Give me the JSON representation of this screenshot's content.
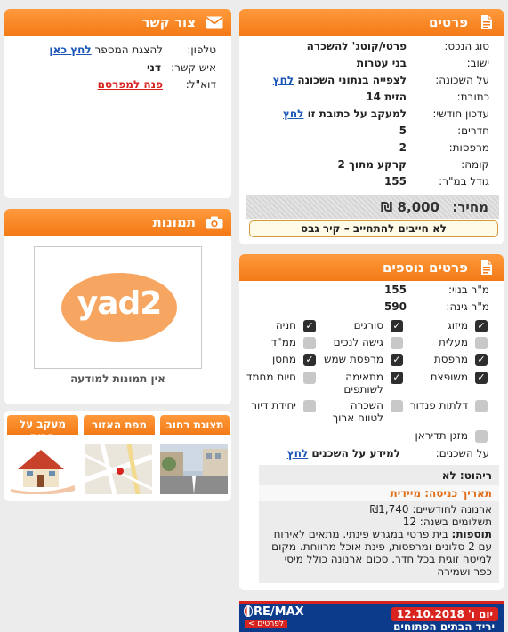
{
  "details": {
    "title": "פרטים",
    "rows": [
      {
        "label": "סוג הנכס:",
        "value": "פרטי/קוטג' להשכרה"
      },
      {
        "label": "ישוב:",
        "value": "בני עטרות"
      },
      {
        "label": "על השכונה:",
        "value": "לצפייה בנתוני השכונה",
        "link": "לחץ"
      },
      {
        "label": "כתובת:",
        "value": "הזית 14"
      },
      {
        "label": "עדכון חודשי:",
        "value": "למעקב על כתובת זו",
        "link": "לחץ"
      },
      {
        "label": "חדרים:",
        "value": "5"
      },
      {
        "label": "מרפסות:",
        "value": "2"
      },
      {
        "label": "קומה:",
        "value": "קרקע מתוך 2"
      },
      {
        "label": "גודל במ\"ר:",
        "value": "155"
      }
    ],
    "price_label": "מחיר:",
    "price_value": "₪ 8,000",
    "no_commitment": "לא חייבים להתחייב – קיר גבס"
  },
  "contact": {
    "title": "צור קשר",
    "phone_label": "טלפון:",
    "phone_text": "להצגת המספר",
    "phone_link": "לחץ כאן",
    "person_label": "איש קשר:",
    "person_value": "דני",
    "email_label": "דוא\"ל:",
    "email_link": "פנה למפרסם"
  },
  "photos": {
    "title": "תמונות",
    "logo_text": "yad2",
    "no_photos": "אין תמונות למודעה"
  },
  "tabs": [
    {
      "label": "תצוגת רחוב"
    },
    {
      "label": "מפת האזור"
    },
    {
      "label": "מעקב על הבית"
    }
  ],
  "extra": {
    "title": "פרטים נוספים",
    "built_label": "מ\"ר בנוי:",
    "built_value": "155",
    "garden_label": "מ\"ר גינה:",
    "garden_value": "590",
    "features": [
      {
        "text": "מיזוג",
        "checked": true
      },
      {
        "text": "סורגים",
        "checked": true
      },
      {
        "text": "חניה",
        "checked": true
      },
      {
        "text": "מעלית",
        "checked": false
      },
      {
        "text": "גישה לנכים",
        "checked": false
      },
      {
        "text": "ממ\"ד",
        "checked": false
      },
      {
        "text": "מרפסת",
        "checked": true
      },
      {
        "text": "מרפסת שמש",
        "checked": true
      },
      {
        "text": "מחסן",
        "checked": true
      },
      {
        "text": "משופצת",
        "checked": true
      },
      {
        "text": "מתאימה לשותפים",
        "checked": true
      },
      {
        "text": "חיות מחמד",
        "checked": false
      },
      {
        "text": "דלתות פנדור",
        "checked": false
      },
      {
        "text": "השכרה לטווח ארוך",
        "checked": false
      },
      {
        "text": "יחידת דיור",
        "checked": false
      },
      {
        "text": "מזגן תדיראן",
        "checked": false
      }
    ],
    "tenants_label": "על השכנים:",
    "tenants_text": "למידע על השכנים",
    "tenants_link": "לחץ",
    "furniture": "ריהוט: לא",
    "entry_date": "תאריך כניסה: מיידית",
    "arnona": "ארנונה לחודשיים: ₪1,740",
    "payments": "תשלומים בשנה: 12",
    "additions_label": "תוספות:",
    "additions_text": "בית פרטי במגרש פינתי. מתאים לאירוח עם 2 סלונים ומרפסות, פינת אוכל מרווחת. מקום למיטה זוגית בכל חדר. סכום ארנונה כולל מיסי כפר ושמירה"
  },
  "banner": {
    "brand": "RE/MAX",
    "date": "יום ו' 12.10.2018",
    "headline": "יריד הבתים הפתוחים",
    "more": "לפרטים >"
  }
}
